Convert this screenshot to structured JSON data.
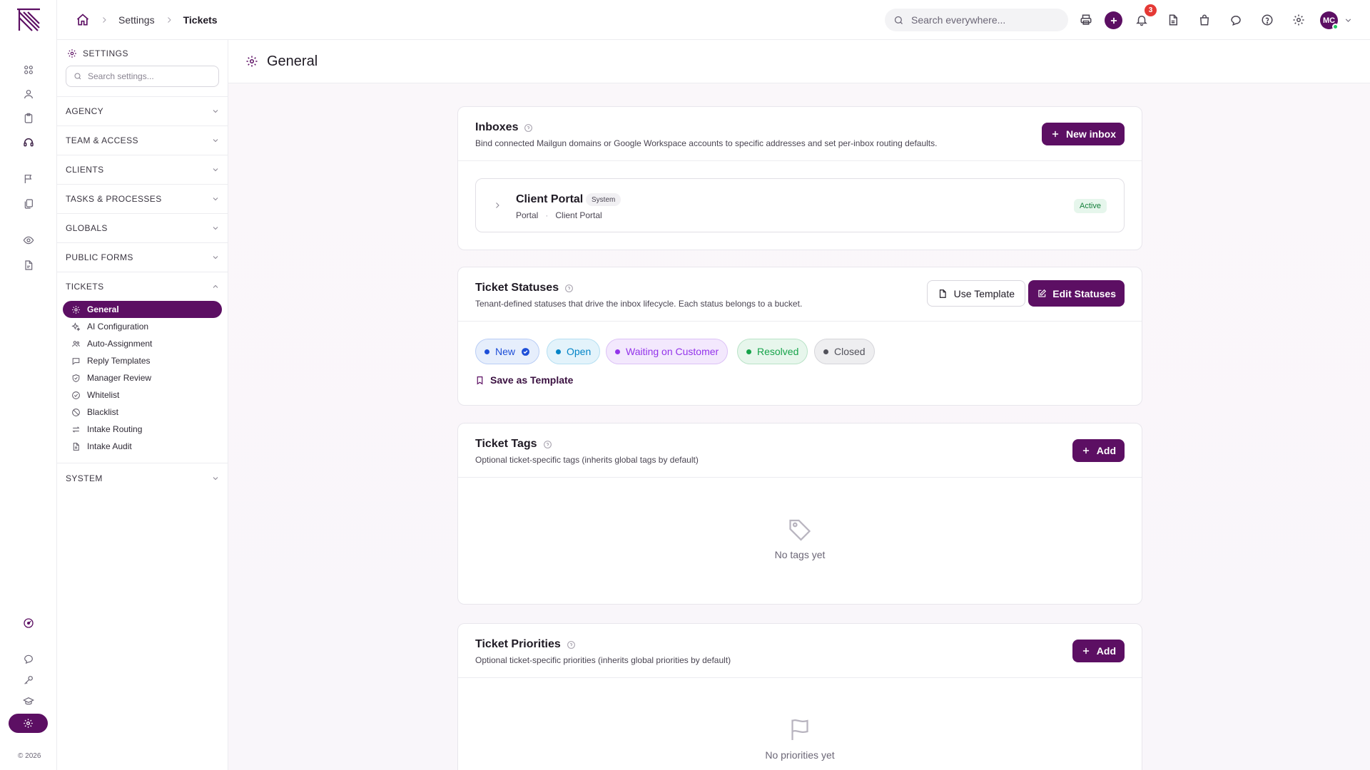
{
  "topbar": {
    "breadcrumb": [
      "Settings",
      "Tickets"
    ],
    "search_placeholder": "Search everywhere...",
    "notification_count": "3",
    "avatar_initials": "MC"
  },
  "rail": {
    "copyright": "© 2026"
  },
  "sidebar": {
    "heading": "SETTINGS",
    "search_placeholder": "Search settings...",
    "sections": [
      "AGENCY",
      "TEAM & ACCESS",
      "CLIENTS",
      "TASKS & PROCESSES",
      "GLOBALS",
      "PUBLIC FORMS",
      "TICKETS",
      "SYSTEM"
    ],
    "tickets_items": [
      {
        "label": "General",
        "icon": "gear-icon",
        "active": true
      },
      {
        "label": "AI Configuration",
        "icon": "sparkles-icon"
      },
      {
        "label": "Auto-Assignment",
        "icon": "users-icon"
      },
      {
        "label": "Reply Templates",
        "icon": "message-icon"
      },
      {
        "label": "Manager Review",
        "icon": "shield-check-icon"
      },
      {
        "label": "Whitelist",
        "icon": "check-circle-icon"
      },
      {
        "label": "Blacklist",
        "icon": "ban-icon"
      },
      {
        "label": "Intake Routing",
        "icon": "arrows-icon"
      },
      {
        "label": "Intake Audit",
        "icon": "file-icon"
      }
    ]
  },
  "page": {
    "title": "General"
  },
  "inboxes": {
    "title": "Inboxes",
    "description": "Bind connected Mailgun domains or Google Workspace accounts to specific addresses and set per-inbox routing defaults.",
    "new_button": "New inbox",
    "items": [
      {
        "name": "Client Portal",
        "badge": "System",
        "meta1": "Portal",
        "meta2": "Client Portal",
        "status": "Active"
      }
    ]
  },
  "statuses": {
    "title": "Ticket Statuses",
    "description": "Tenant-defined statuses that drive the inbox lifecycle. Each status belongs to a bucket.",
    "use_template": "Use Template",
    "edit_statuses": "Edit Statuses",
    "save_template": "Save as Template",
    "items": [
      {
        "label": "New",
        "color": "#1d4ed8",
        "bg": "#e6eefc",
        "border": "#b9cdf5"
      },
      {
        "label": "Open",
        "color": "#0284c7",
        "bg": "#e3f3fb",
        "border": "#b5dff2"
      },
      {
        "label": "Waiting on Customer",
        "color": "#9333ea",
        "bg": "#f3e8fd",
        "border": "#dcc2f6"
      },
      {
        "label": "Resolved",
        "color": "#16a34a",
        "bg": "#e7f6ec",
        "border": "#b9e3c7"
      },
      {
        "label": "Closed",
        "color": "#52525b",
        "bg": "#eeeef0",
        "border": "#d5d5da"
      }
    ]
  },
  "tags": {
    "title": "Ticket Tags",
    "description": "Optional ticket-specific tags (inherits global tags by default)",
    "add_button": "Add",
    "empty": "No tags yet"
  },
  "priorities": {
    "title": "Ticket Priorities",
    "description": "Optional ticket-specific priorities (inherits global priorities by default)",
    "add_button": "Add",
    "empty": "No priorities yet"
  },
  "colors": {
    "brand": "#5c0f63",
    "success": "#16a34a",
    "notification": "#e53935"
  }
}
